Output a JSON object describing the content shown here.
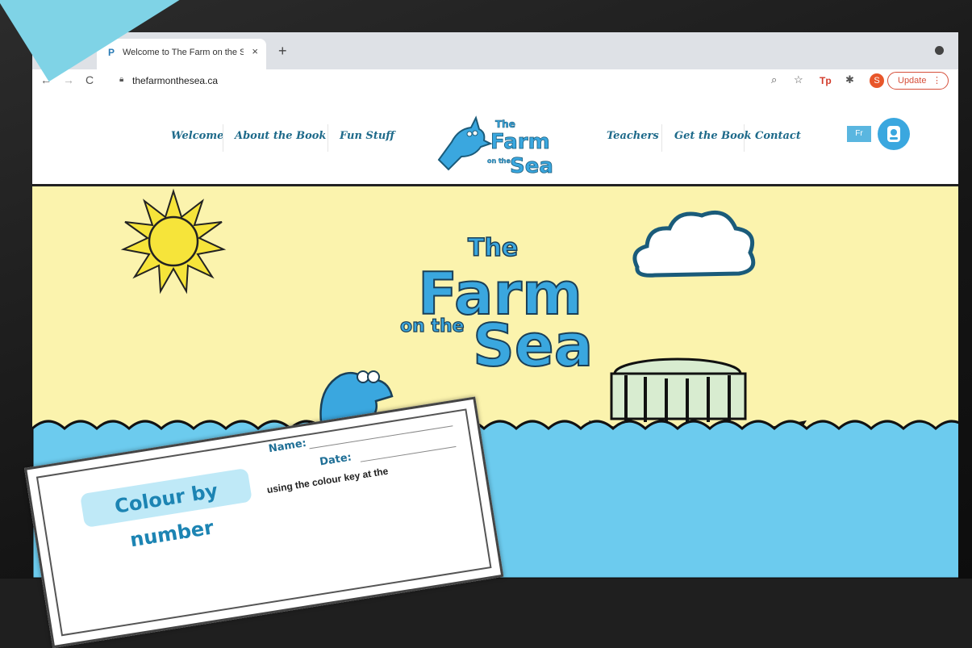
{
  "browser": {
    "tab_title": "Welcome to The Farm on the S",
    "tab_close": "×",
    "new_tab": "+",
    "url": "thefarmonthesea.ca",
    "avatar_initial": "S",
    "update_label": "Update",
    "update_menu": "⋮",
    "nav_back": "←",
    "nav_forward": "→",
    "nav_reload": "C",
    "zoom_icon": "⌕",
    "star_icon": "☆",
    "ext_tp": "Tp",
    "ext_puzzle": "✱"
  },
  "site": {
    "nav_left": [
      "Welcome",
      "About the Book",
      "Fun Stuff"
    ],
    "nav_right": [
      "Teachers",
      "Get the Book",
      "Contact"
    ],
    "logo": {
      "line1": "The",
      "line2": "Farm",
      "line3": "on the",
      "line4": "Sea"
    },
    "lang_button": "Fr"
  },
  "hero": {
    "title": {
      "line1": "The",
      "line2": "Farm",
      "line3": "on the",
      "line4": "Sea"
    }
  },
  "worksheet": {
    "badge": "Colour by number",
    "name_label": "Name:",
    "date_label": "Date:",
    "instruction": "using the colour key at the"
  },
  "colors": {
    "brand_blue": "#2f9fcf",
    "sky": "#fbf3ad",
    "sea": "#6ccbee",
    "nav_text": "#1e6a8a",
    "update_red": "#d64f3a"
  }
}
